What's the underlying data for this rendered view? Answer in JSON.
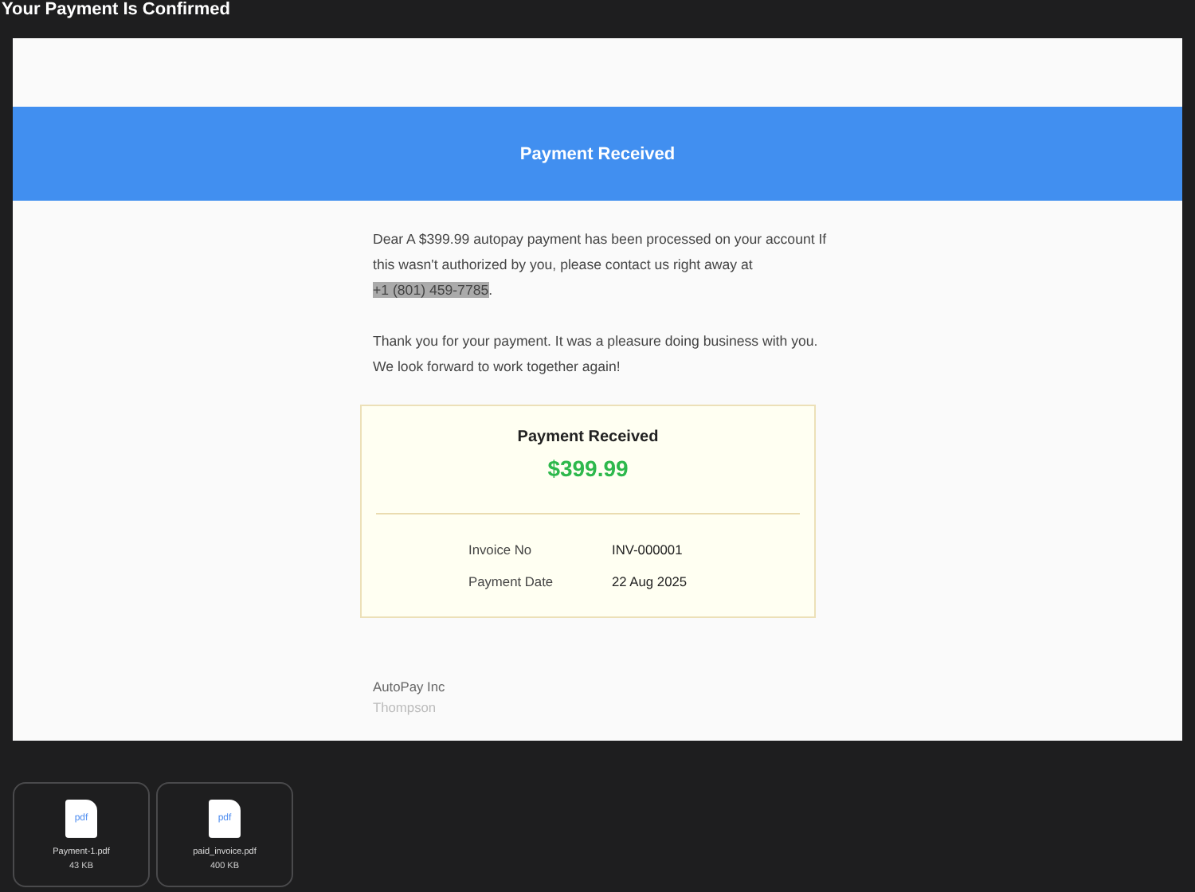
{
  "title": "Your Payment Is Confirmed",
  "email": {
    "banner": "Payment Received",
    "message": "Dear A $399.99 autopay payment has been processed on your account If this wasn't authorized by you, please contact us right away at ",
    "phone": "+1 (801) 459-7785",
    "message_end": ".",
    "thanks": "Thank you for your payment. It was a pleasure doing business with you. We look forward to work together again!",
    "receipt": {
      "title": "Payment Received",
      "amount": "$399.99",
      "rows": [
        {
          "label": "Invoice No",
          "value": "INV-000001"
        },
        {
          "label": "Payment Date",
          "value": "22 Aug 2025"
        }
      ]
    },
    "company": "AutoPay Inc",
    "signer": "Thompson"
  },
  "attachments": [
    {
      "type": "pdf",
      "name": "Payment-1.pdf",
      "size": "43 KB"
    },
    {
      "type": "pdf",
      "name": "paid_invoice.pdf",
      "size": "400 KB"
    }
  ]
}
